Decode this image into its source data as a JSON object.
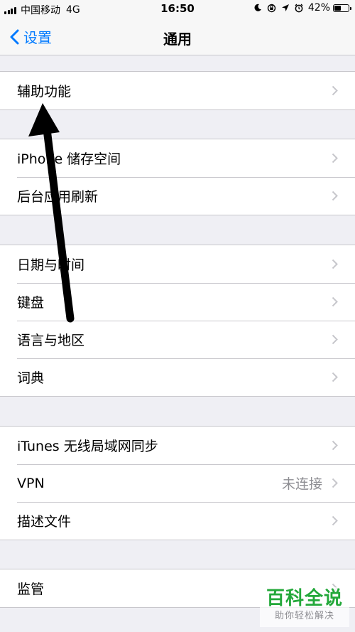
{
  "status_bar": {
    "carrier": "中国移动",
    "network": "4G",
    "time": "16:50",
    "battery_percent_text": "42%",
    "battery_level": 0.42,
    "icons": [
      "moon-icon",
      "rotation-lock-icon",
      "location-arrow-icon",
      "alarm-icon"
    ]
  },
  "nav": {
    "back_label": "设置",
    "title": "通用"
  },
  "groups": [
    {
      "rows": [
        {
          "label": "辅助功能"
        }
      ]
    },
    {
      "rows": [
        {
          "label": "iPhone 储存空间"
        },
        {
          "label": "后台应用刷新"
        }
      ]
    },
    {
      "rows": [
        {
          "label": "日期与时间"
        },
        {
          "label": "键盘"
        },
        {
          "label": "语言与地区"
        },
        {
          "label": "词典"
        }
      ]
    },
    {
      "rows": [
        {
          "label": "iTunes 无线局域网同步"
        },
        {
          "label": "VPN",
          "value": "未连接"
        },
        {
          "label": "描述文件"
        }
      ]
    },
    {
      "rows": [
        {
          "label": "监管"
        }
      ]
    }
  ],
  "watermark": {
    "main": "百科全说",
    "sub": "助你轻松解决"
  },
  "colors": {
    "accent": "#007aff",
    "background": "#efeff4",
    "separator": "#c8c7cc",
    "chevron": "#c7c7cc",
    "watermark_green": "#23a83a"
  }
}
